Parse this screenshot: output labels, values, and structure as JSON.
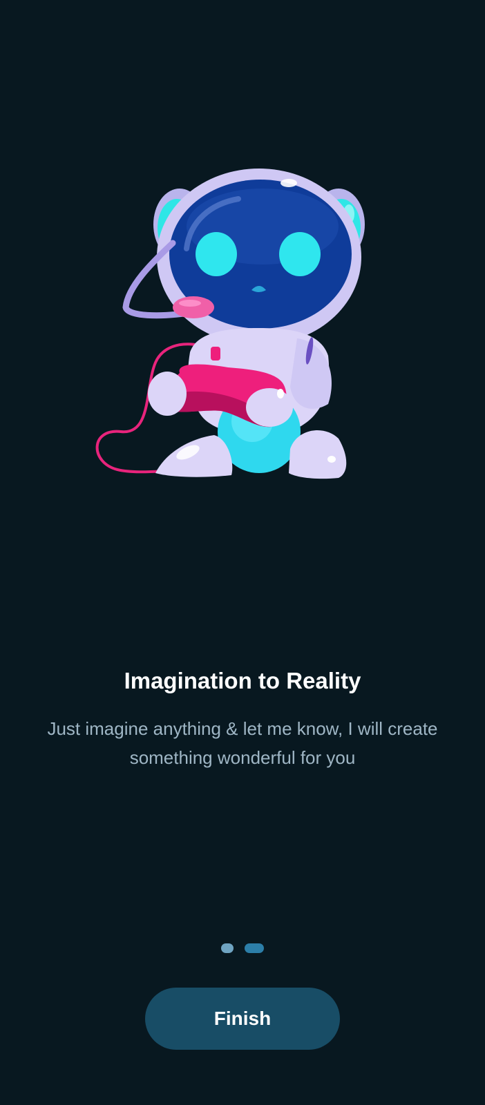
{
  "onboarding": {
    "title": "Imagination to Reality",
    "description_lines": [
      "Just imagine anything & let me know, I will create",
      "something wonderful for you"
    ],
    "illustration_icon": "robot-gamer-icon",
    "pagination": {
      "total": 2,
      "current": 2
    },
    "finish_label": "Finish"
  },
  "colors": {
    "background": "#081820",
    "title": "#ffffff",
    "description": "#9fb6c5",
    "button_bg": "#184d66",
    "dot_inactive": "#6fa4c2",
    "dot_active": "#2c7ea8"
  }
}
